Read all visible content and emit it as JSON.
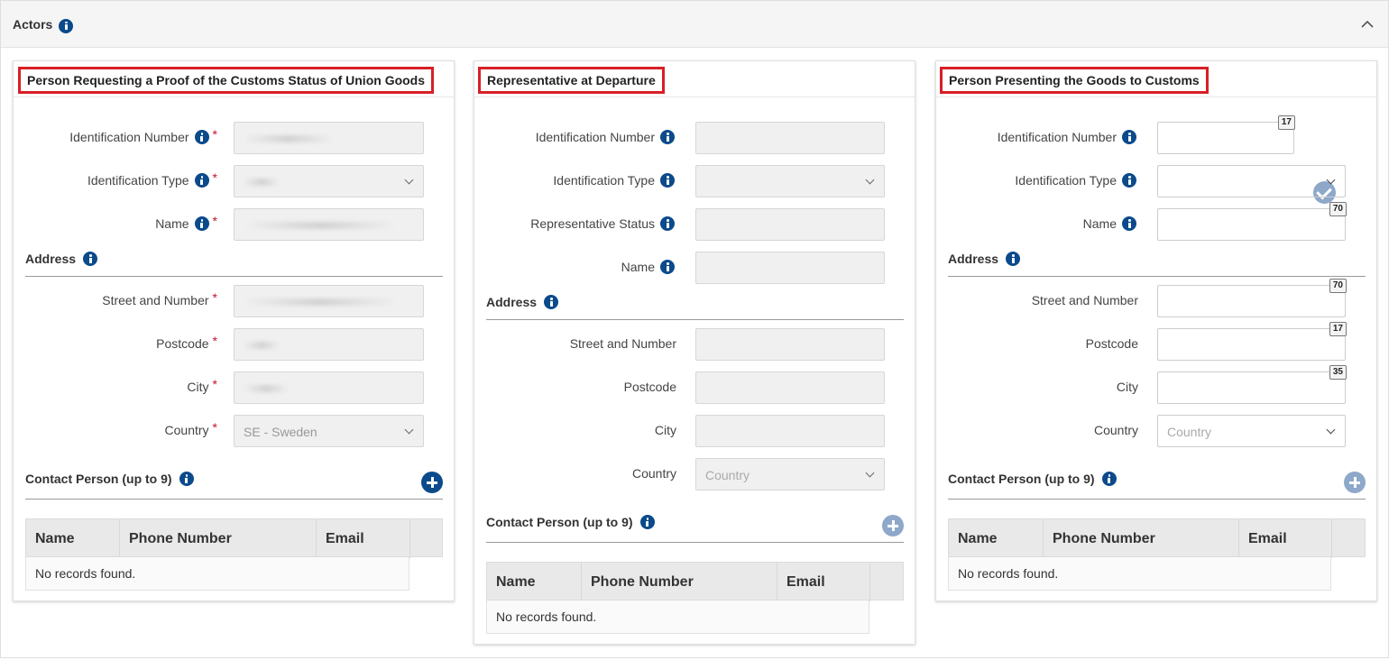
{
  "section": {
    "title": "Actors"
  },
  "panels": {
    "p1": {
      "title": "Person Requesting a Proof of the Customs Status of Union Goods",
      "id_label": "Identification Number",
      "idtype_label": "Identification Type",
      "name_label": "Name",
      "address_label": "Address",
      "street_label": "Street and Number",
      "postcode_label": "Postcode",
      "city_label": "City",
      "country_label": "Country",
      "country_value": "SE - Sweden",
      "required_mark": "*",
      "contact_label": "Contact Person (up to 9)",
      "table_headers": [
        "Name",
        "Phone Number",
        "Email"
      ],
      "empty_text": "No records found."
    },
    "p2": {
      "title": "Representative at Departure",
      "id_label": "Identification Number",
      "idtype_label": "Identification Type",
      "status_label": "Representative Status",
      "name_label": "Name",
      "address_label": "Address",
      "street_label": "Street and Number",
      "postcode_label": "Postcode",
      "city_label": "City",
      "country_label": "Country",
      "country_placeholder": "Country",
      "contact_label": "Contact Person (up to 9)",
      "table_headers": [
        "Name",
        "Phone Number",
        "Email"
      ],
      "empty_text": "No records found."
    },
    "p3": {
      "title": "Person Presenting the Goods to Customs",
      "id_label": "Identification Number",
      "id_counter": "17",
      "idtype_label": "Identification Type",
      "name_label": "Name",
      "name_counter": "70",
      "address_label": "Address",
      "street_label": "Street and Number",
      "street_counter": "70",
      "postcode_label": "Postcode",
      "postcode_counter": "17",
      "city_label": "City",
      "city_counter": "35",
      "country_label": "Country",
      "country_placeholder": "Country",
      "contact_label": "Contact Person (up to 9)",
      "table_headers": [
        "Name",
        "Phone Number",
        "Email"
      ],
      "empty_text": "No records found."
    }
  },
  "colors": {
    "brand": "#0b4a8b",
    "highlight": "#d71f27",
    "required": "#c8102e",
    "dim_button": "#8da8c9"
  }
}
